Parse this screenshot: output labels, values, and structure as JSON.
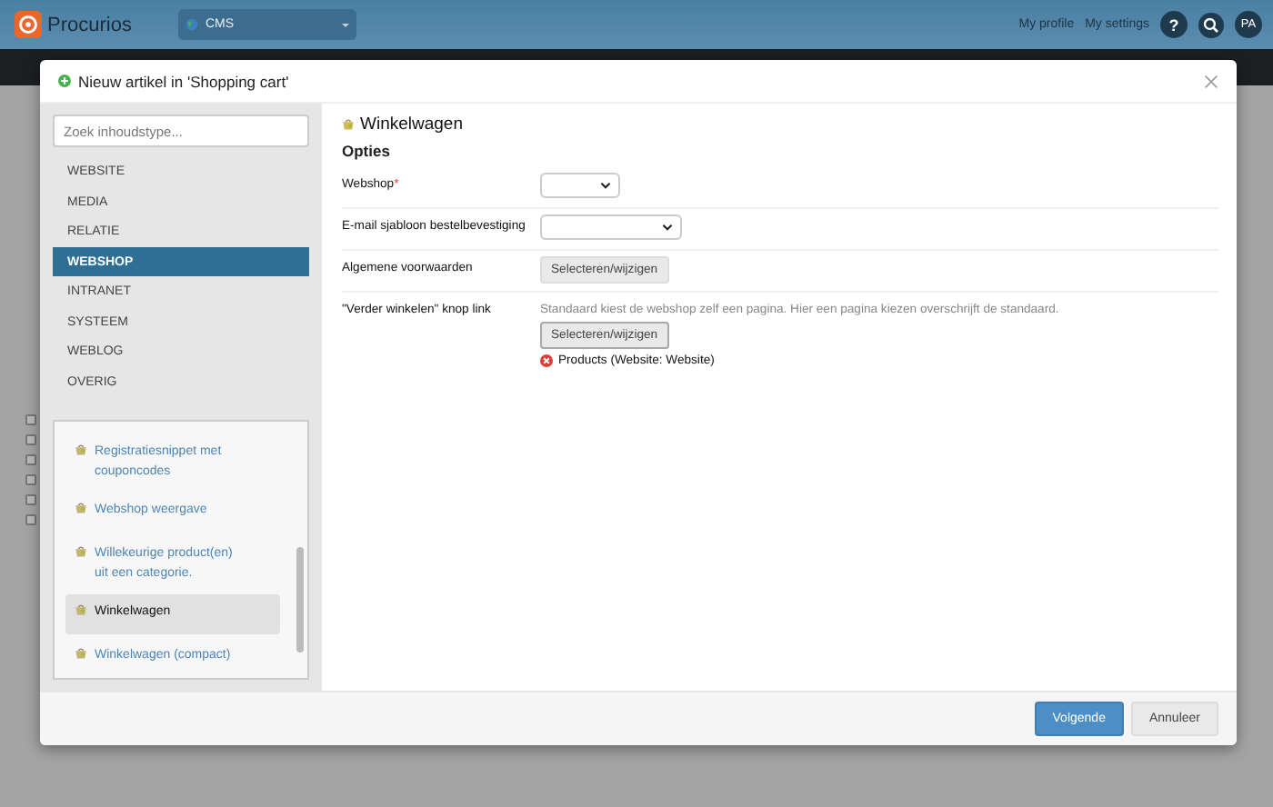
{
  "topbar": {
    "logo": "Procurios",
    "site_select": "CMS",
    "links": [
      "My profile",
      "My settings"
    ],
    "help": "?",
    "avatar": "PA"
  },
  "dialog": {
    "title": "Nieuw artikel in 'Shopping cart'",
    "search": {
      "placeholder": "Zoek inhoudstype..."
    },
    "categories": [
      {
        "label": "WEBSITE",
        "selected": false
      },
      {
        "label": "MEDIA",
        "selected": false
      },
      {
        "label": "RELATIE",
        "selected": false
      },
      {
        "label": "WEBSHOP",
        "selected": true
      },
      {
        "label": "INTRANET",
        "selected": false
      },
      {
        "label": "SYSTEEM",
        "selected": false
      },
      {
        "label": "WEBLOG",
        "selected": false
      },
      {
        "label": "OVERIG",
        "selected": false
      }
    ],
    "content_types": [
      {
        "label": "Registratiesnippet met couponcodes",
        "selected": false
      },
      {
        "label": "Webshop weergave",
        "selected": false
      },
      {
        "label": "Willekeurige product(en) uit een categorie.",
        "selected": false
      },
      {
        "label": "Winkelwagen",
        "selected": true
      },
      {
        "label": "Winkelwagen (compact)",
        "selected": false
      }
    ],
    "panel_title": "Winkelwagen",
    "section": "Opties",
    "fields": [
      {
        "kind": "select",
        "label": "Webshop",
        "required_mark": "*"
      },
      {
        "kind": "select",
        "label": "E-mail sjabloon bestelbevestiging"
      },
      {
        "kind": "button",
        "label": "Algemene voorwaarden",
        "button": "Selecteren/wijzigen"
      },
      {
        "kind": "link",
        "label": "\"Verder winkelen\" knop link",
        "hint": "Standaard kiest de webshop zelf een pagina. Hier een pagina kiezen overschrijft de standaard.",
        "button": "Selecteren/wijzigen",
        "value": "Products (Website: Website)"
      }
    ],
    "buttons": [
      {
        "kind": "primary",
        "label": "Volgende"
      },
      {
        "kind": "secondary",
        "label": "Annuleer"
      }
    ]
  }
}
